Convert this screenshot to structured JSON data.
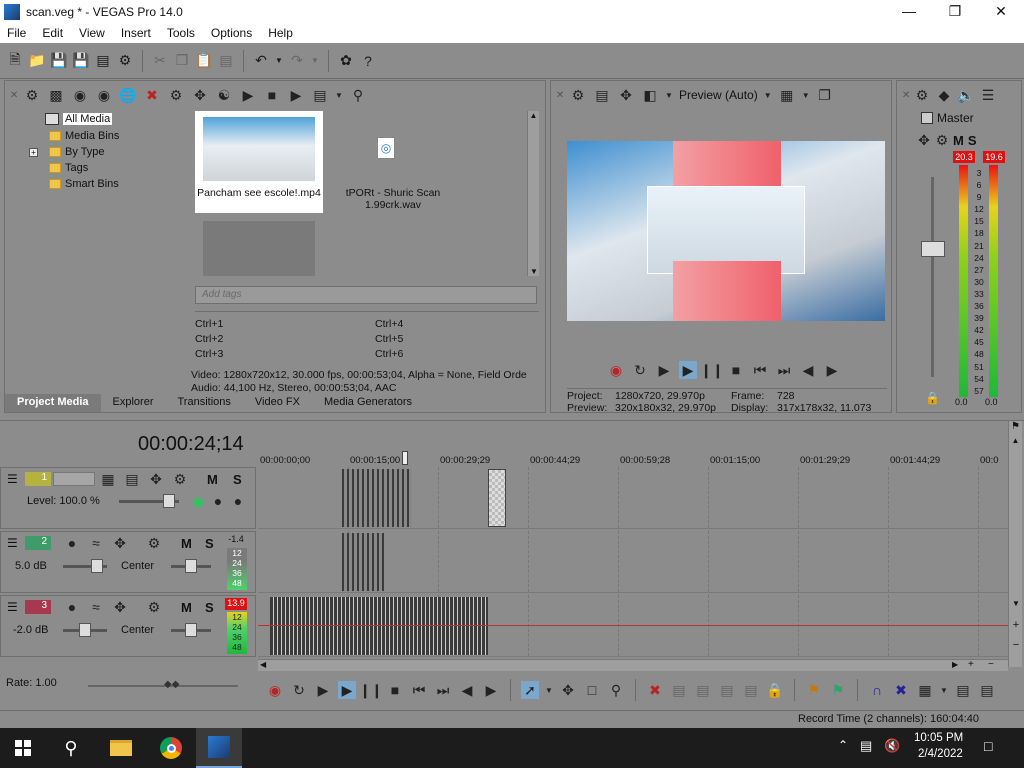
{
  "window": {
    "title": "scan.veg * - VEGAS Pro 14.0",
    "app_icon": "vegas-logo-icon"
  },
  "menu": [
    "File",
    "Edit",
    "View",
    "Insert",
    "Tools",
    "Options",
    "Help"
  ],
  "project_media": {
    "tree": [
      {
        "label": "All Media",
        "selected": true
      },
      {
        "label": "Media Bins"
      },
      {
        "label": "By Type",
        "expandable": true
      },
      {
        "label": "Tags"
      },
      {
        "label": "Smart Bins"
      }
    ],
    "items": [
      {
        "name": "Pancham see escole!.mp4",
        "type": "video"
      },
      {
        "name": "tPORt - Shuric Scan 1.99crk.wav",
        "type": "audio"
      }
    ],
    "tag_placeholder": "Add tags",
    "shortcuts": [
      "Ctrl+1",
      "Ctrl+2",
      "Ctrl+3",
      "Ctrl+4",
      "Ctrl+5",
      "Ctrl+6"
    ],
    "info_video": "Video: 1280x720x12, 30.000 fps, 00:00:53;04, Alpha = None, Field Orde",
    "info_audio": "Audio: 44,100 Hz, Stereo, 00:00:53;04, AAC",
    "tabs": [
      "Project Media",
      "Explorer",
      "Transitions",
      "Video FX",
      "Media Generators"
    ]
  },
  "preview": {
    "mode": "Preview (Auto)",
    "project_label": "Project:",
    "project_value": "1280x720, 29.970p",
    "preview_label": "Preview:",
    "preview_value": "320x180x32, 29.970p",
    "frame_label": "Frame:",
    "frame_value": "728",
    "display_label": "Display:",
    "display_value": "317x178x32, 11.073"
  },
  "master": {
    "label": "Master",
    "peak_left": "20.3",
    "peak_right": "19.6",
    "scale": [
      "3",
      "6",
      "9",
      "12",
      "15",
      "18",
      "21",
      "24",
      "27",
      "30",
      "33",
      "36",
      "39",
      "42",
      "45",
      "48",
      "51",
      "54",
      "57"
    ],
    "level_left": "0.0",
    "level_right": "0.0"
  },
  "timeline": {
    "timecode": "00:00:24;14",
    "ruler": [
      "00:00:00;00",
      "00:00:15;00",
      "00:00:29;29",
      "00:00:44;29",
      "00:00:59;28",
      "00:01:15;00",
      "00:01:29;29",
      "00:01:44;29",
      "00:0"
    ],
    "tracks": [
      {
        "num": "1",
        "kind": "video",
        "level": "Level: 100.0 %",
        "color": "#c9c64a"
      },
      {
        "num": "2",
        "kind": "audio",
        "volume": "5.0 dB",
        "pan": "Center",
        "peak": "-1.4",
        "meter": [
          "12",
          "24",
          "36",
          "48"
        ],
        "color": "#3f9b6a"
      },
      {
        "num": "3",
        "kind": "audio",
        "volume": "-2.0 dB",
        "pan": "Center",
        "peak": "13.9",
        "meter": [
          "12",
          "24",
          "36",
          "48"
        ],
        "color": "#a7384e"
      }
    ],
    "rate": "Rate: 1.00"
  },
  "status": {
    "record_time": "Record Time (2 channels): 160:04:40"
  },
  "taskbar": {
    "time": "10:05 PM",
    "date": "2/4/2022",
    "apps": [
      "windows-start-icon",
      "search-icon",
      "file-explorer-icon",
      "chrome-icon",
      "vegas-icon"
    ]
  }
}
